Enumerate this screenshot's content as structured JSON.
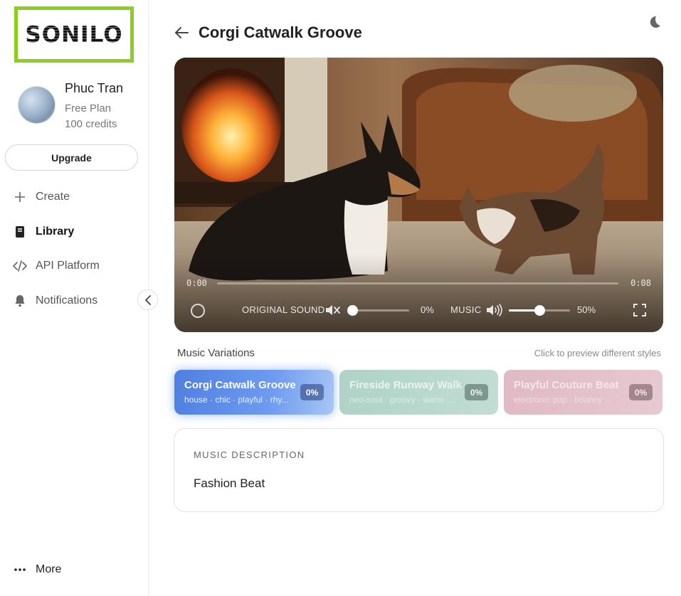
{
  "brand": {
    "logo_text": "SONILO",
    "logo_frame_color": "#8ccf1a"
  },
  "user": {
    "name": "Phuc Tran",
    "plan": "Free Plan",
    "credits": "100 credits"
  },
  "sidebar": {
    "upgrade_label": "Upgrade",
    "items": [
      {
        "label": "Create",
        "icon": "plus-icon"
      },
      {
        "label": "Library",
        "icon": "book-icon",
        "active": true
      },
      {
        "label": "API Platform",
        "icon": "code-icon"
      },
      {
        "label": "Notifications",
        "icon": "bell-icon"
      }
    ],
    "more_label": "More"
  },
  "header": {
    "title": "Corgi Catwalk Groove"
  },
  "player": {
    "current_time": "0:00",
    "total_time": "0:08",
    "original_sound_label": "ORIGINAL SOUND",
    "original_sound_pct": "0%",
    "music_label": "MUSIC",
    "music_pct": "50%",
    "original_sound_level": 0,
    "music_level": 0.5
  },
  "variations": {
    "title": "Music Variations",
    "hint": "Click to preview different styles",
    "items": [
      {
        "title": "Corgi Catwalk Groove",
        "tags": "house · chic · playful · rhy...",
        "badge": "0%",
        "selected": true
      },
      {
        "title": "Fireside Runway Walk",
        "tags": "neo-soul · groovy · warm ...",
        "badge": "0%"
      },
      {
        "title": "Playful Couture Beat",
        "tags": "electronic pop · bouncy ...",
        "badge": "0%"
      }
    ]
  },
  "description": {
    "label": "MUSIC DESCRIPTION",
    "value": "Fashion Beat"
  },
  "colors": {
    "accent": "#4f7fe0",
    "card2": "#aed3c6",
    "card3": "#e0b9c4"
  }
}
